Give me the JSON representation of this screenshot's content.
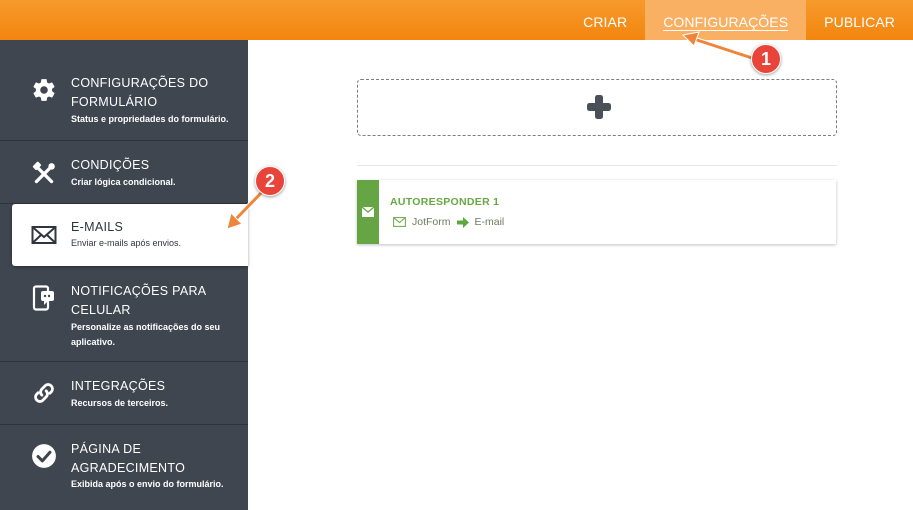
{
  "header": {
    "tabs": [
      {
        "label": "CRIAR"
      },
      {
        "label": "CONFIGURAÇÕES",
        "active": true
      },
      {
        "label": "PUBLICAR"
      }
    ],
    "accent_color": "#f5891a"
  },
  "sidebar": {
    "items": [
      {
        "title": "CONFIGURAÇÕES DO FORMULÁRIO",
        "subtitle": "Status e propriedades do formulário.",
        "icon": "gear-icon"
      },
      {
        "title": "CONDIÇÕES",
        "subtitle": "Criar lógica condicional.",
        "icon": "tools-icon"
      },
      {
        "title": "E-MAILS",
        "subtitle": "Enviar e-mails após envios.",
        "icon": "envelope-icon",
        "active": true
      },
      {
        "title": "NOTIFICAÇÕES PARA CELULAR",
        "subtitle": "Personalize as notificações do seu aplicativo.",
        "icon": "mobile-notification-icon"
      },
      {
        "title": "INTEGRAÇÕES",
        "subtitle": "Recursos de terceiros.",
        "icon": "link-icon"
      },
      {
        "title": "PÁGINA DE AGRADECIMENTO",
        "subtitle": "Exibida após o envio do formulário.",
        "icon": "check-circle-icon"
      }
    ]
  },
  "main": {
    "add_button_icon": "plus-icon",
    "email_card": {
      "title": "AUTORESPONDER 1",
      "from": "JotForm",
      "to": "E-mail",
      "color": "#65a543"
    }
  },
  "annotations": {
    "badge_1": "1",
    "badge_2": "2",
    "arrow_color": "#f0843a",
    "badge_color": "#e8443a"
  }
}
